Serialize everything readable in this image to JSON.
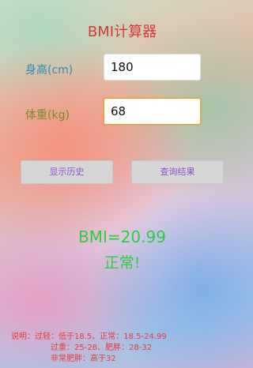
{
  "app": {
    "title": "BMI计算器"
  },
  "form": {
    "height_label": "身高(cm)",
    "height_value": "180",
    "weight_label": "体重(kg)",
    "weight_value": "68"
  },
  "buttons": {
    "history_label": "显示历史",
    "query_label": "查询结果"
  },
  "result": {
    "bmi_text": "BMI=20.99",
    "status_text": "正常!"
  },
  "notes": {
    "line1": "说明：过轻：低于18.5、正常：18.5-24.99",
    "line2": "过重：25-28、肥胖：28-32",
    "line3": "非常肥胖：高于32"
  },
  "colors": {
    "title": "#d43a3a",
    "height_label": "#2b8cb8",
    "weight_label": "#7a8a2a",
    "button_text": "#8a55c8",
    "result": "#2ecc40",
    "note": "#e63c3c",
    "focus_border": "#f0a020"
  }
}
